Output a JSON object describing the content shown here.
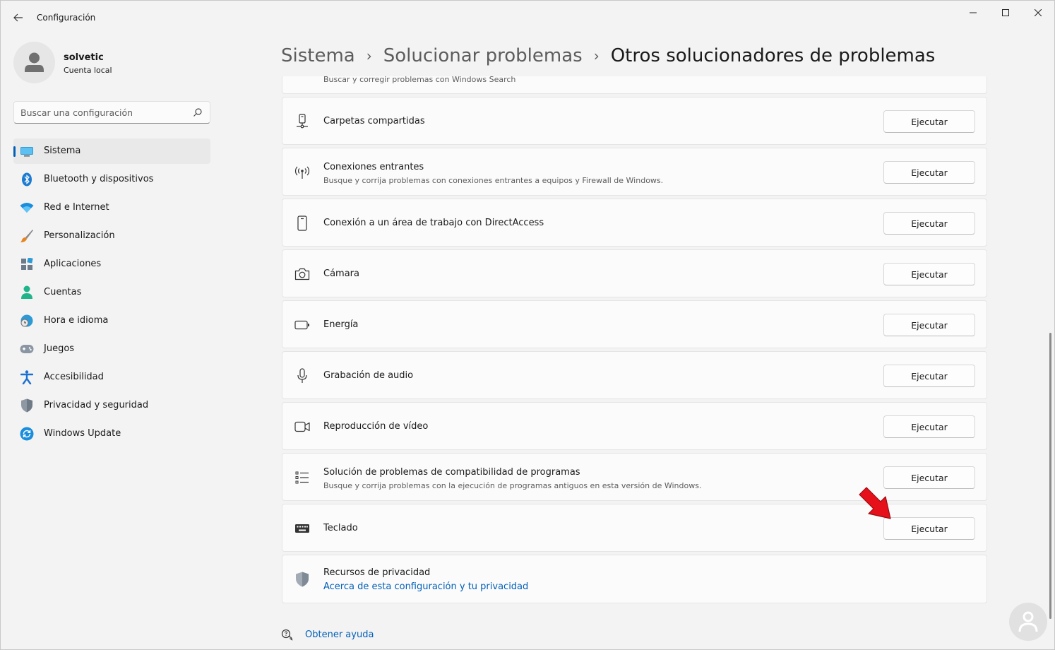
{
  "window": {
    "title": "Configuración",
    "back_icon": "arrow-left-icon",
    "controls": [
      "minimize-icon",
      "maximize-icon",
      "close-icon"
    ]
  },
  "profile": {
    "name": "solvetic",
    "account_type": "Cuenta local"
  },
  "search": {
    "placeholder": "Buscar una configuración",
    "value": ""
  },
  "sidebar": {
    "active_index": 0,
    "items": [
      {
        "label": "Sistema",
        "icon": "monitor-icon"
      },
      {
        "label": "Bluetooth y dispositivos",
        "icon": "bluetooth-icon"
      },
      {
        "label": "Red e Internet",
        "icon": "wifi-icon"
      },
      {
        "label": "Personalización",
        "icon": "brush-icon"
      },
      {
        "label": "Aplicaciones",
        "icon": "apps-icon"
      },
      {
        "label": "Cuentas",
        "icon": "person-icon"
      },
      {
        "label": "Hora e idioma",
        "icon": "clock-globe-icon"
      },
      {
        "label": "Juegos",
        "icon": "gamepad-icon"
      },
      {
        "label": "Accesibilidad",
        "icon": "accessibility-icon"
      },
      {
        "label": "Privacidad y seguridad",
        "icon": "shield-icon"
      },
      {
        "label": "Windows Update",
        "icon": "update-icon"
      }
    ]
  },
  "breadcrumb": {
    "items": [
      "Sistema",
      "Solucionar problemas",
      "Otros solucionadores de problemas"
    ],
    "separator": "›"
  },
  "troubleshooters": {
    "partial_top_desc": "Buscar y corregir problemas con Windows Search",
    "run_label": "Ejecutar",
    "items": [
      {
        "title": "Carpetas compartidas",
        "desc": "",
        "icon": "network-drive-icon"
      },
      {
        "title": "Conexiones entrantes",
        "desc": "Busque y corrija problemas con conexiones entrantes a equipos y Firewall de Windows.",
        "icon": "antenna-icon"
      },
      {
        "title": "Conexión a un área de trabajo con DirectAccess",
        "desc": "",
        "icon": "phone-icon"
      },
      {
        "title": "Cámara",
        "desc": "",
        "icon": "camera-icon"
      },
      {
        "title": "Energía",
        "desc": "",
        "icon": "battery-icon"
      },
      {
        "title": "Grabación de audio",
        "desc": "",
        "icon": "microphone-icon"
      },
      {
        "title": "Reproducción de vídeo",
        "desc": "",
        "icon": "video-icon"
      },
      {
        "title": "Solución de problemas de compatibilidad de programas",
        "desc": "Busque y corrija problemas con la ejecución de programas antiguos en esta versión de Windows.",
        "icon": "list-icon"
      },
      {
        "title": "Teclado",
        "desc": "",
        "icon": "keyboard-icon"
      }
    ]
  },
  "privacy": {
    "title": "Recursos de privacidad",
    "link": "Acerca de esta configuración y tu privacidad",
    "icon": "shield-icon"
  },
  "help": {
    "label": "Obtener ayuda",
    "icon": "help-chat-icon"
  },
  "colors": {
    "accent": "#005fb8",
    "annotation_arrow": "#e5101a"
  }
}
